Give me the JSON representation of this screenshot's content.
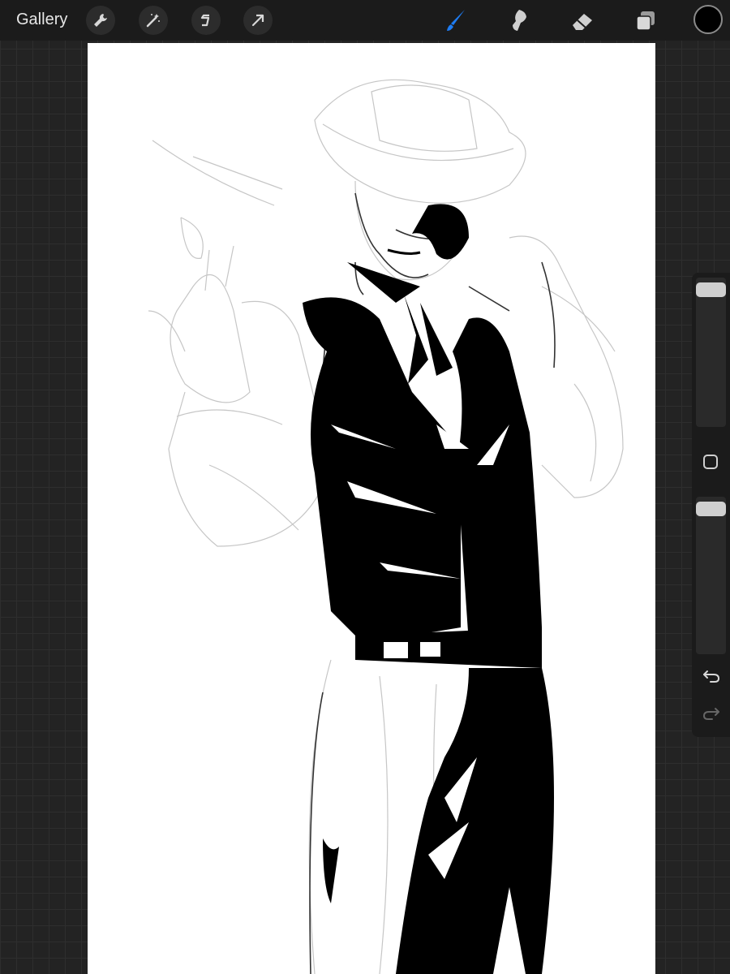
{
  "topbar": {
    "gallery_label": "Gallery",
    "left_tools": [
      "wrench-icon",
      "magic-wand-icon",
      "selection-s-icon",
      "transform-arrow-icon"
    ],
    "right_tools": [
      "brush-icon",
      "smudge-icon",
      "eraser-icon",
      "layers-icon"
    ],
    "active_tool": "brush",
    "active_color": "#000000",
    "accent_color": "#1e7cf2"
  },
  "sidebar": {
    "brush_size_level": 0.0,
    "opacity_level": 0.0,
    "buttons": [
      "undo-icon",
      "redo-icon"
    ]
  },
  "canvas": {
    "background": "#ffffff"
  }
}
